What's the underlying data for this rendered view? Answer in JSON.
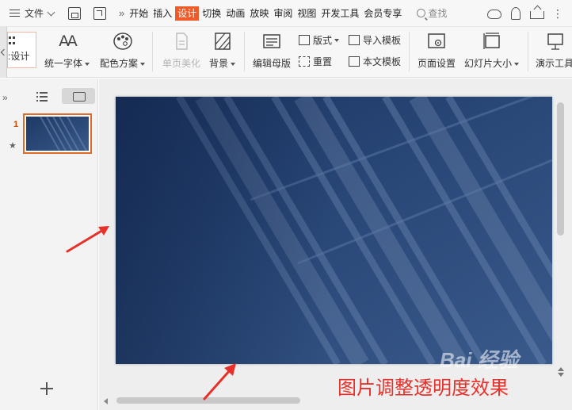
{
  "menubar": {
    "file_label": "文件",
    "tabs": [
      {
        "label": "开始",
        "active": false
      },
      {
        "label": "插入",
        "active": false
      },
      {
        "label": "设计",
        "active": true
      },
      {
        "label": "切换",
        "active": false
      },
      {
        "label": "动画",
        "active": false
      },
      {
        "label": "放映",
        "active": false
      },
      {
        "label": "审阅",
        "active": false
      },
      {
        "label": "视图",
        "active": false
      },
      {
        "label": "开发工具",
        "active": false
      },
      {
        "label": "会员专享",
        "active": false
      }
    ],
    "search_label": "查找",
    "more_glyph": "»",
    "dots_glyph": "⋮"
  },
  "ribbon": {
    "design_label": ":设计",
    "unify_font": "统一字体",
    "color_scheme": "配色方案",
    "single_page_beautify": "单页美化",
    "background": "背景",
    "edit_master": "编辑母版",
    "layout": "版式",
    "reset": "重置",
    "import_template": "导入模板",
    "this_template": "本文模板",
    "page_setup": "页面设置",
    "slide_size": "幻灯片大小",
    "present_tools": "演示工具",
    "font_icon_text": "AA"
  },
  "leftpanel": {
    "collapse_glyph": "»",
    "slide_number": "1",
    "star_glyph": "★"
  },
  "annotation": {
    "caption": "图片调整透明度效果",
    "watermark": "Bai 经验"
  },
  "colors": {
    "accent": "#f05a28",
    "slide_bg": "#2a4775",
    "caption": "#e8302a",
    "arrow": "#e8302a"
  }
}
